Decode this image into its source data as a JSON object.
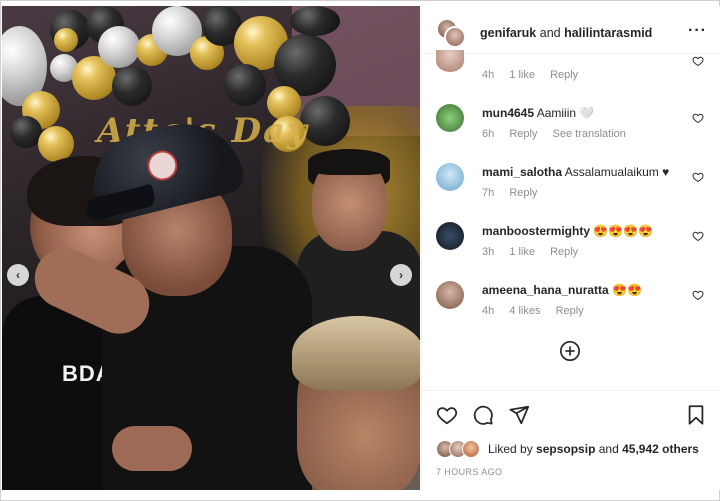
{
  "header": {
    "user1": "genifaruk",
    "connector": "and",
    "user2": "halilintarasmid",
    "more_icon": "more-horizontal-icon"
  },
  "photo": {
    "sign_text": "Atta's Day",
    "shirt_text": "BDAY B",
    "prev_icon": "chevron-left-icon",
    "next_icon": "chevron-right-icon"
  },
  "comments": [
    {
      "username": "",
      "text": "",
      "time": "4h",
      "likes": "1 like",
      "reply": "Reply",
      "avatar_color": "#c9a9a0"
    },
    {
      "username": "mun4645",
      "text": "Aamiiin 🤍",
      "time": "6h",
      "likes": "",
      "reply": "Reply",
      "translate": "See translation",
      "avatar_color": "#4f7a45"
    },
    {
      "username": "mami_salotha",
      "text": "Assalamualaikum ♥",
      "time": "7h",
      "likes": "",
      "reply": "Reply",
      "avatar_color": "#7fb4d8"
    },
    {
      "username": "manboostermighty",
      "text": "😍😍😍😍",
      "time": "3h",
      "likes": "1 like",
      "reply": "Reply",
      "avatar_color": "#1e2a3a"
    },
    {
      "username": "ameena_hana_nuratta",
      "text": "😍😍",
      "time": "4h",
      "likes": "4 likes",
      "reply": "Reply",
      "avatar_color": "#b58a76"
    }
  ],
  "actions": {
    "like_icon": "heart-icon",
    "comment_icon": "comment-icon",
    "share_icon": "send-icon",
    "save_icon": "bookmark-icon"
  },
  "likes": {
    "prefix": "Liked by",
    "user": "sepsopsip",
    "middle": "and",
    "count": "45,942 others"
  },
  "timestamp": "7 HOURS AGO",
  "colors": {
    "link_blue": "#00376b",
    "meta_gray": "#8e8e8e",
    "heart_red": "#c0152f"
  }
}
